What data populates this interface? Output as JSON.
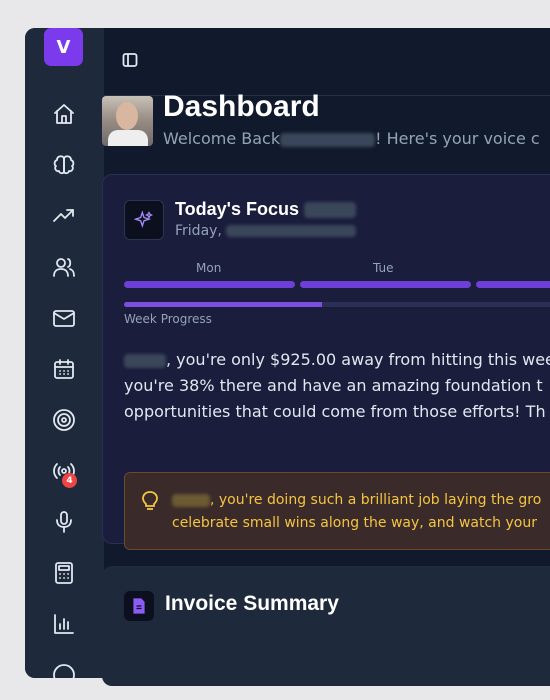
{
  "app": {
    "logo_letter": "V"
  },
  "sidebar": {
    "items": [
      {
        "icon": "home-icon"
      },
      {
        "icon": "brain-icon"
      },
      {
        "icon": "trending-up-icon"
      },
      {
        "icon": "users-icon"
      },
      {
        "icon": "mail-icon"
      },
      {
        "icon": "calendar-icon"
      },
      {
        "icon": "target-icon"
      },
      {
        "icon": "broadcast-icon",
        "badge": "4"
      },
      {
        "icon": "microphone-icon"
      },
      {
        "icon": "calculator-icon"
      },
      {
        "icon": "bar-chart-icon"
      }
    ]
  },
  "header": {
    "title": "Dashboard",
    "welcome_prefix": "Welcome Back",
    "welcome_suffix": "! Here's your voice c"
  },
  "focus": {
    "title": "Today's Focus",
    "date_prefix": "Friday,",
    "days": [
      "Mon",
      "Tue"
    ],
    "week_progress_label": "Week Progress",
    "week_progress": 0.45,
    "message_line1": ", you're only $925.00 away from hitting this wee",
    "message_line2": "you're 38% there and have an amazing foundation t",
    "message_line3": "opportunities that could come from those efforts! Th",
    "tip_line1": ", you're doing such a brilliant job laying the gro",
    "tip_line2": "celebrate small wins along the way, and watch your"
  },
  "invoice": {
    "title": "Invoice Summary"
  },
  "colors": {
    "accent": "#7c3aed",
    "tip": "#f5c542",
    "badge": "#ef4444"
  }
}
